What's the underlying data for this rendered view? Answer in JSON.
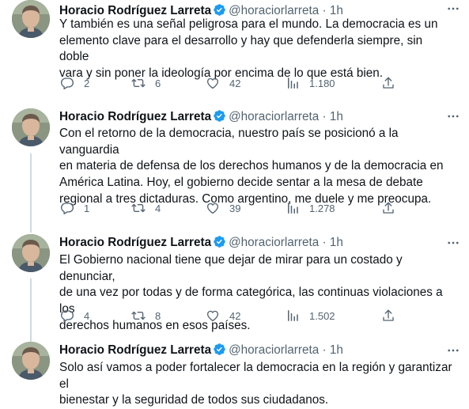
{
  "tweets": [
    {
      "author": "Horacio Rodríguez Larreta",
      "handle": "@horaciorlarreta",
      "separator": "·",
      "time": "1h",
      "text": "Y también es una señal peligrosa para el mundo. La democracia es un\nelemento clave para el desarrollo y hay que defenderla siempre, sin doble\nvara y sin poner la ideología por encima de lo que está bien.",
      "replies": "2",
      "retweets": "6",
      "likes": "42",
      "views": "1.180"
    },
    {
      "author": "Horacio Rodríguez Larreta",
      "handle": "@horaciorlarreta",
      "separator": "·",
      "time": "1h",
      "text": "Con el retorno de la democracia, nuestro país se posicionó a la vanguardia\nen materia de defensa de los derechos humanos y de la democracia en\nAmérica Latina. Hoy, el gobierno decide sentar a la mesa de debate\nregional a tres dictaduras. Como argentino, me duele y me preocupa.",
      "replies": "1",
      "retweets": "4",
      "likes": "39",
      "views": "1.278"
    },
    {
      "author": "Horacio Rodríguez Larreta",
      "handle": "@horaciorlarreta",
      "separator": "·",
      "time": "1h",
      "text": "El Gobierno nacional tiene que dejar de mirar para un costado y denunciar,\nde una vez por todas y de forma categórica, las continuas violaciones a los\nderechos humanos en esos países.",
      "replies": "4",
      "retweets": "8",
      "likes": "42",
      "views": "1.502"
    },
    {
      "author": "Horacio Rodríguez Larreta",
      "handle": "@horaciorlarreta",
      "separator": "·",
      "time": "1h",
      "text": "Solo así vamos a poder fortalecer la democracia en la región y garantizar el\nbienestar y la seguridad de todos sus ciudadanos.",
      "replies": "",
      "retweets": "",
      "likes": "",
      "views": ""
    }
  ],
  "colors": {
    "text": "#0f1419",
    "secondary": "#536471",
    "verified": "#1d9bf0",
    "thread_line": "#cfd9de"
  },
  "icons": {
    "verified": "verified-badge-icon",
    "more": "more-dots-icon",
    "reply": "reply-icon",
    "retweet": "retweet-icon",
    "like": "heart-icon",
    "views": "views-chart-icon",
    "share": "share-icon"
  }
}
